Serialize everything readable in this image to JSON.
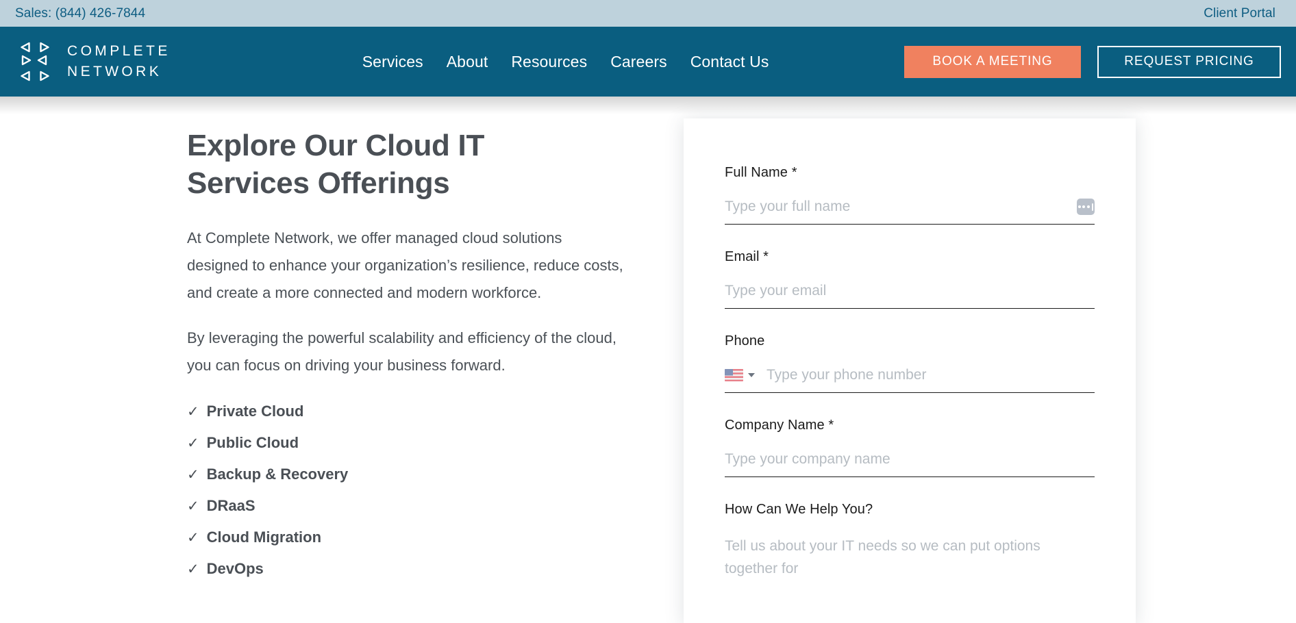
{
  "topbar": {
    "sales_label": "Sales: (844) 426-7844",
    "client_portal_label": "Client Portal"
  },
  "header": {
    "logo_line1": "COMPLETE",
    "logo_line2": "NETWORK",
    "nav": [
      {
        "label": "Services"
      },
      {
        "label": "About"
      },
      {
        "label": "Resources"
      },
      {
        "label": "Careers"
      },
      {
        "label": "Contact Us"
      }
    ],
    "cta_primary": "BOOK A MEETING",
    "cta_secondary": "REQUEST PRICING"
  },
  "main": {
    "title": "Explore Our Cloud IT Services Offerings",
    "paragraph1": "At Complete Network, we offer managed cloud solutions designed to enhance your organization’s resilience, reduce costs, and create a more connected and modern workforce.",
    "paragraph2": "By leveraging the powerful scalability and efficiency of the cloud, you can focus on driving your business forward.",
    "check_glyph": "✓",
    "features": [
      {
        "label": "Private Cloud"
      },
      {
        "label": "Public Cloud"
      },
      {
        "label": "Backup & Recovery"
      },
      {
        "label": "DRaaS"
      },
      {
        "label": "Cloud Migration"
      },
      {
        "label": "DevOps"
      }
    ]
  },
  "form": {
    "full_name": {
      "label": "Full Name *",
      "placeholder": "Type your full name",
      "value": ""
    },
    "email": {
      "label": "Email *",
      "placeholder": "Type your email",
      "value": ""
    },
    "phone": {
      "label": "Phone",
      "placeholder": "Type your phone number",
      "value": "",
      "country_flag": "us-flag-icon"
    },
    "company": {
      "label": "Company Name *",
      "placeholder": "Type your company name",
      "value": ""
    },
    "message": {
      "label": "How Can We Help You?",
      "placeholder": "Tell us about your IT needs so we can put options together for",
      "value": ""
    }
  },
  "colors": {
    "topbar_bg": "#bed2dc",
    "topbar_text": "#0e5d82",
    "header_bg": "#0a5e80",
    "accent": "#f0815f",
    "heading_text": "#4a4f55"
  }
}
